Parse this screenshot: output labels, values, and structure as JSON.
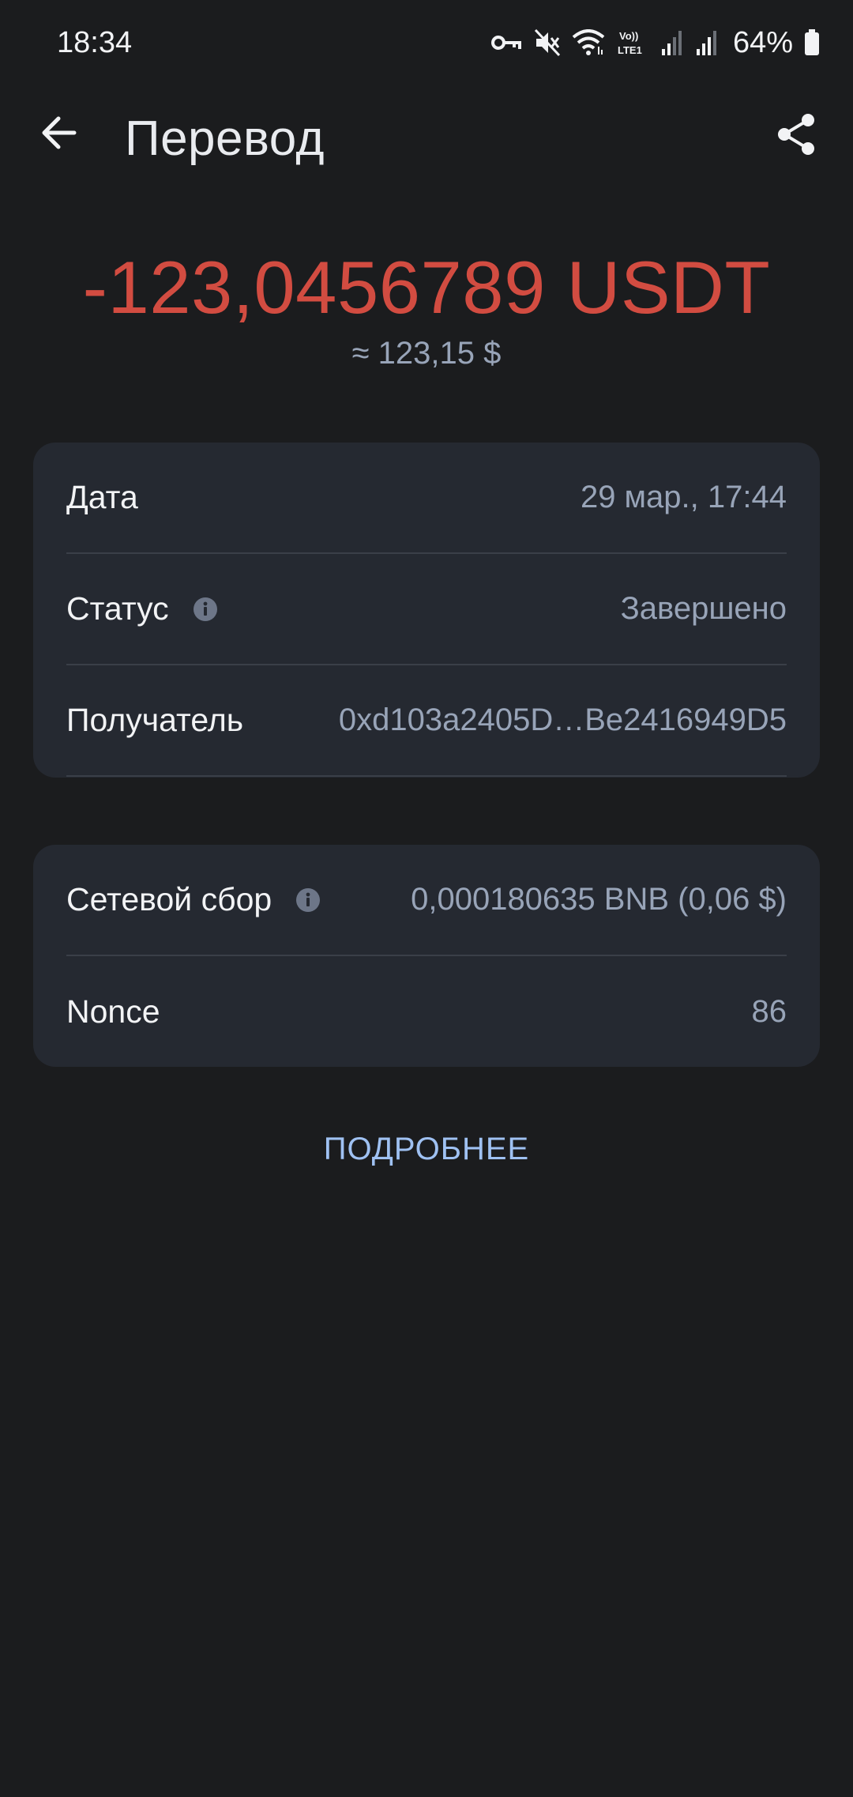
{
  "status_bar": {
    "time": "18:34",
    "battery": "64%",
    "network_label": "VoLTE1",
    "icons": [
      "vpn-key-icon",
      "mute-icon",
      "wifi-icon",
      "volte-icon",
      "signal-icon",
      "signal-icon",
      "battery-icon"
    ]
  },
  "app_bar": {
    "title": "Перевод",
    "back_icon": "arrow-left-icon",
    "share_icon": "share-icon"
  },
  "amount": {
    "value": "-123,0456789 USDT",
    "fiat": "≈ 123,15 $",
    "color": "#d24c41"
  },
  "details": {
    "rows": [
      {
        "label": "Дата",
        "value": "29 мар., 17:44",
        "info": false
      },
      {
        "label": "Статус",
        "value": "Завершено",
        "info": true
      },
      {
        "label": "Получатель",
        "value": "0xd103a2405D…Be2416949D5",
        "info": false
      }
    ]
  },
  "fees": {
    "rows": [
      {
        "label": "Сетевой сбор",
        "value": "0,000180635 BNB (0,06 $)",
        "info": true
      },
      {
        "label": "Nonce",
        "value": "86",
        "info": false
      }
    ]
  },
  "more_button": {
    "label": "ПОДРОБНЕЕ",
    "color": "#9fc1f2"
  }
}
